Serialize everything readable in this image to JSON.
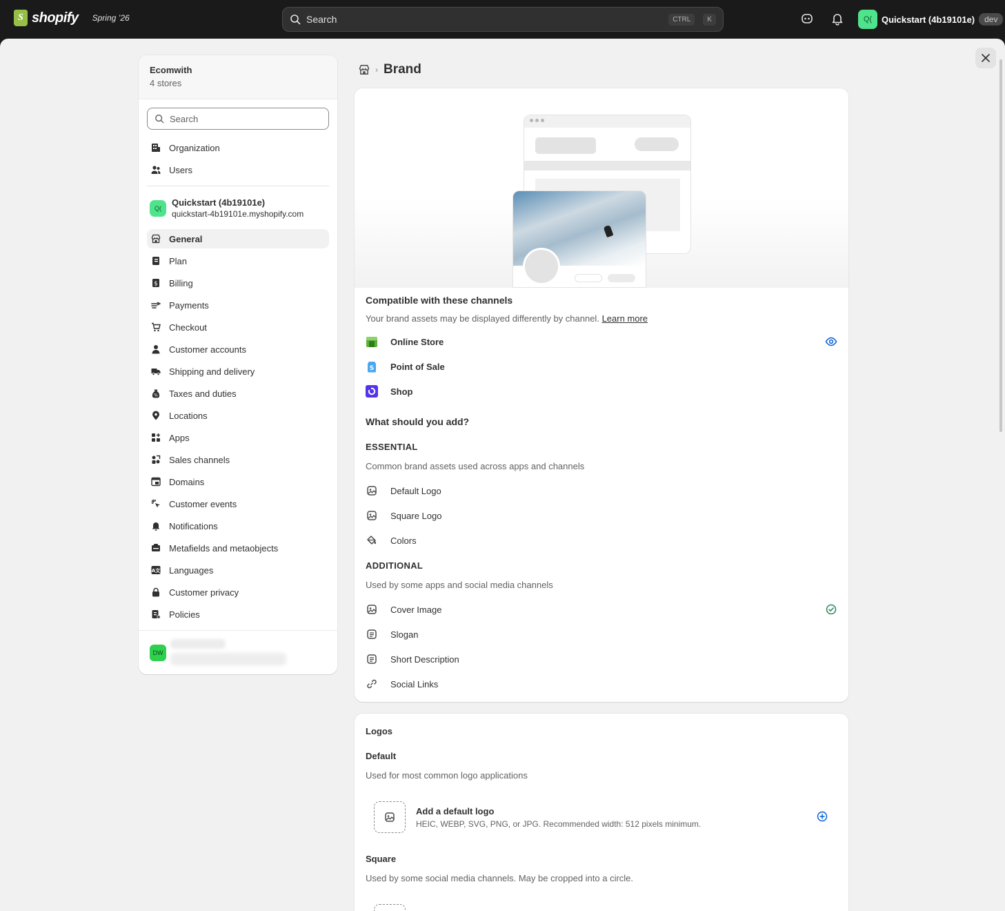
{
  "topbar": {
    "brand": "shopify",
    "edition": "Spring ’26",
    "search_placeholder": "Search",
    "kbd_ctrl": "CTRL",
    "kbd_key": "K",
    "store_initials": "Q(",
    "store_name": "Quickstart (4b19101e)",
    "env_badge": "dev"
  },
  "sidebar": {
    "org_name": "Ecomwith",
    "org_stores": "4 stores",
    "search_placeholder": "Search",
    "org_items": [
      {
        "label": "Organization",
        "icon": "building-icon"
      },
      {
        "label": "Users",
        "icon": "users-icon"
      }
    ],
    "store": {
      "initials": "Q(",
      "name": "Quickstart (4b19101e)",
      "domain": "quickstart-4b19101e.myshopify.com"
    },
    "items": [
      {
        "label": "General",
        "icon": "store-icon",
        "active": true
      },
      {
        "label": "Plan",
        "icon": "plan-icon"
      },
      {
        "label": "Billing",
        "icon": "billing-icon"
      },
      {
        "label": "Payments",
        "icon": "payments-icon"
      },
      {
        "label": "Checkout",
        "icon": "cart-icon"
      },
      {
        "label": "Customer accounts",
        "icon": "person-icon"
      },
      {
        "label": "Shipping and delivery",
        "icon": "truck-icon"
      },
      {
        "label": "Taxes and duties",
        "icon": "tax-icon"
      },
      {
        "label": "Locations",
        "icon": "location-icon"
      },
      {
        "label": "Apps",
        "icon": "apps-icon"
      },
      {
        "label": "Sales channels",
        "icon": "channels-icon"
      },
      {
        "label": "Domains",
        "icon": "domains-icon"
      },
      {
        "label": "Customer events",
        "icon": "cursor-icon"
      },
      {
        "label": "Notifications",
        "icon": "bell-icon"
      },
      {
        "label": "Metafields and metaobjects",
        "icon": "metafields-icon"
      },
      {
        "label": "Languages",
        "icon": "language-icon"
      },
      {
        "label": "Customer privacy",
        "icon": "lock-icon"
      },
      {
        "label": "Policies",
        "icon": "policies-icon"
      }
    ],
    "footer_initials": "DW"
  },
  "breadcrumb": {
    "title": "Brand"
  },
  "brand_card": {
    "compatible_title": "Compatible with these channels",
    "compatible_desc": "Your brand assets may be displayed differently by channel.",
    "learn_more": "Learn more",
    "channels": [
      {
        "label": "Online Store",
        "color": "#5fb13c"
      },
      {
        "label": "Point of Sale",
        "color": "#4aa8f0"
      },
      {
        "label": "Shop",
        "color": "#5433eb"
      }
    ],
    "question": "What should you add?",
    "essential_title": "ESSENTIAL",
    "essential_desc": "Common brand assets used across apps and channels",
    "essential_items": [
      {
        "label": "Default Logo",
        "icon": "image-icon"
      },
      {
        "label": "Square Logo",
        "icon": "image-icon"
      },
      {
        "label": "Colors",
        "icon": "paint-bucket-icon"
      }
    ],
    "additional_title": "ADDITIONAL",
    "additional_desc": "Used by some apps and social media channels",
    "additional_items": [
      {
        "label": "Cover Image",
        "icon": "image-icon"
      },
      {
        "label": "Slogan",
        "icon": "text-icon"
      },
      {
        "label": "Short Description",
        "icon": "text-icon"
      },
      {
        "label": "Social Links",
        "icon": "link-icon"
      }
    ]
  },
  "logos_card": {
    "title": "Logos",
    "default_title": "Default",
    "default_desc": "Used for most common logo applications",
    "upload_title": "Add a default logo",
    "upload_desc": "HEIC, WEBP, SVG, PNG, or JPG. Recommended width: 512 pixels minimum.",
    "square_title": "Square",
    "square_desc": "Used by some social media channels. May be cropped into a circle."
  },
  "colors": {
    "accent": "#005bd3",
    "success": "#29845a"
  }
}
